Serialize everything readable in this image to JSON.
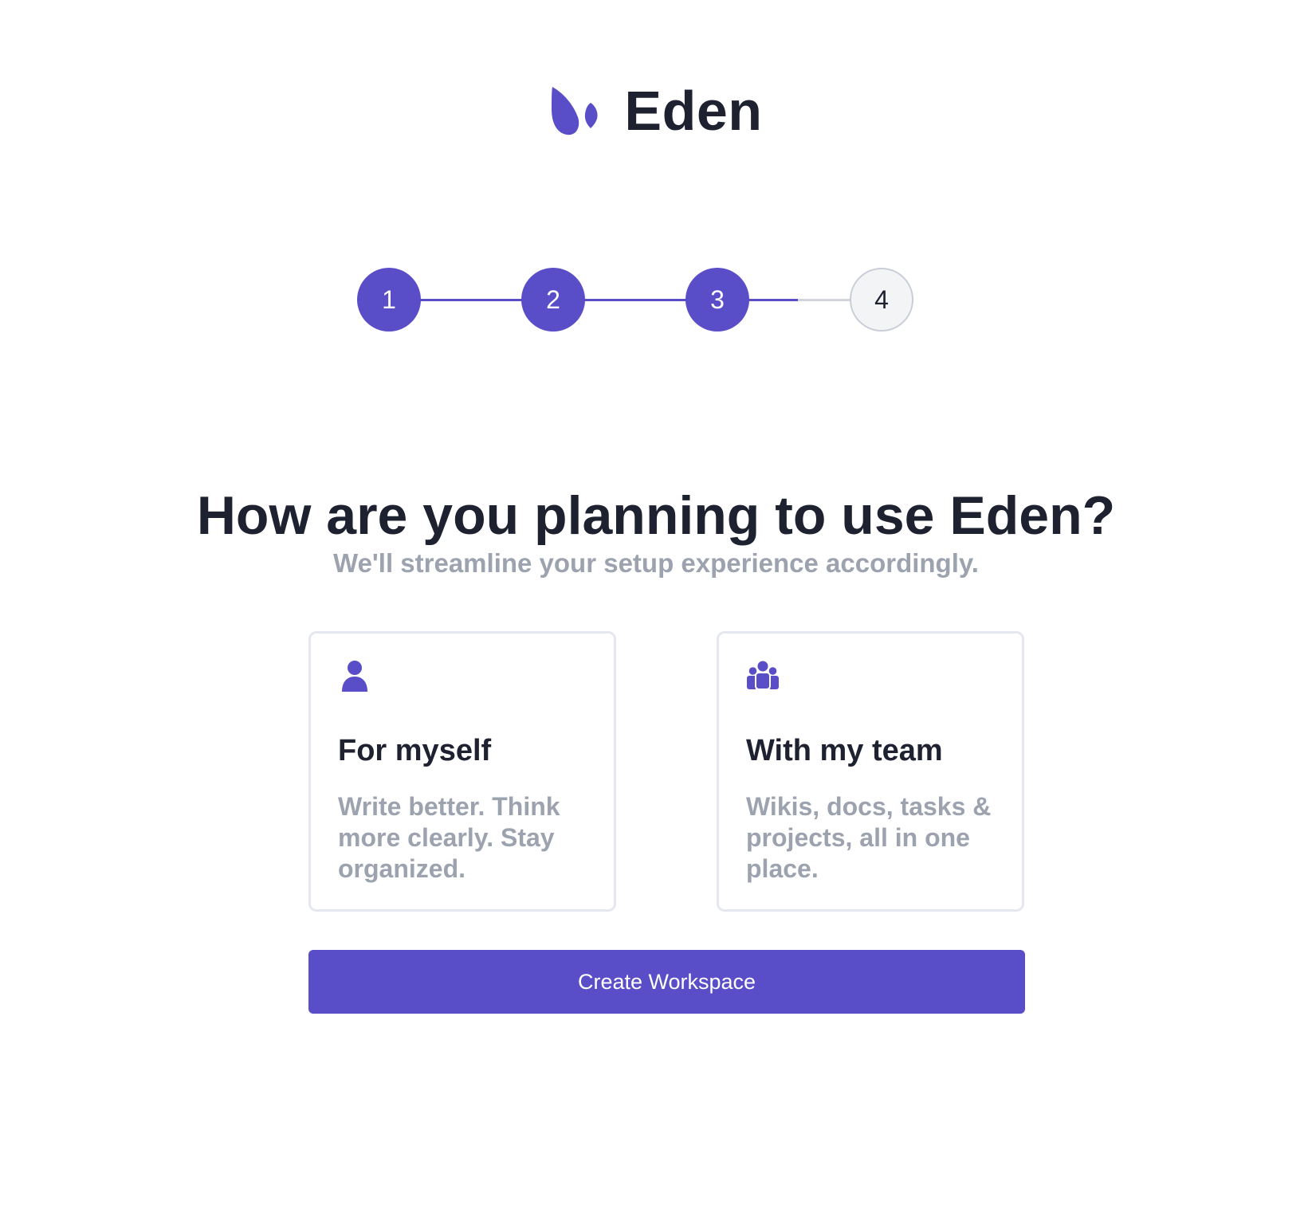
{
  "brand": {
    "name": "Eden",
    "logo_icon": "eden-leaf-logo",
    "accent_color": "#5a4dc8"
  },
  "stepper": {
    "steps": [
      {
        "label": "1",
        "state": "complete"
      },
      {
        "label": "2",
        "state": "complete"
      },
      {
        "label": "3",
        "state": "current"
      },
      {
        "label": "4",
        "state": "pending"
      }
    ]
  },
  "main": {
    "title": "How are you planning to use Eden?",
    "subtitle": "We'll streamline your setup experience accordingly."
  },
  "options": [
    {
      "icon": "user-icon",
      "title": "For myself",
      "description": "Write better. Think more clearly. Stay organized."
    },
    {
      "icon": "users-icon",
      "title": "With my team",
      "description": "Wikis, docs, tasks & projects, all in one place."
    }
  ],
  "actions": {
    "create_label": "Create Workspace"
  }
}
